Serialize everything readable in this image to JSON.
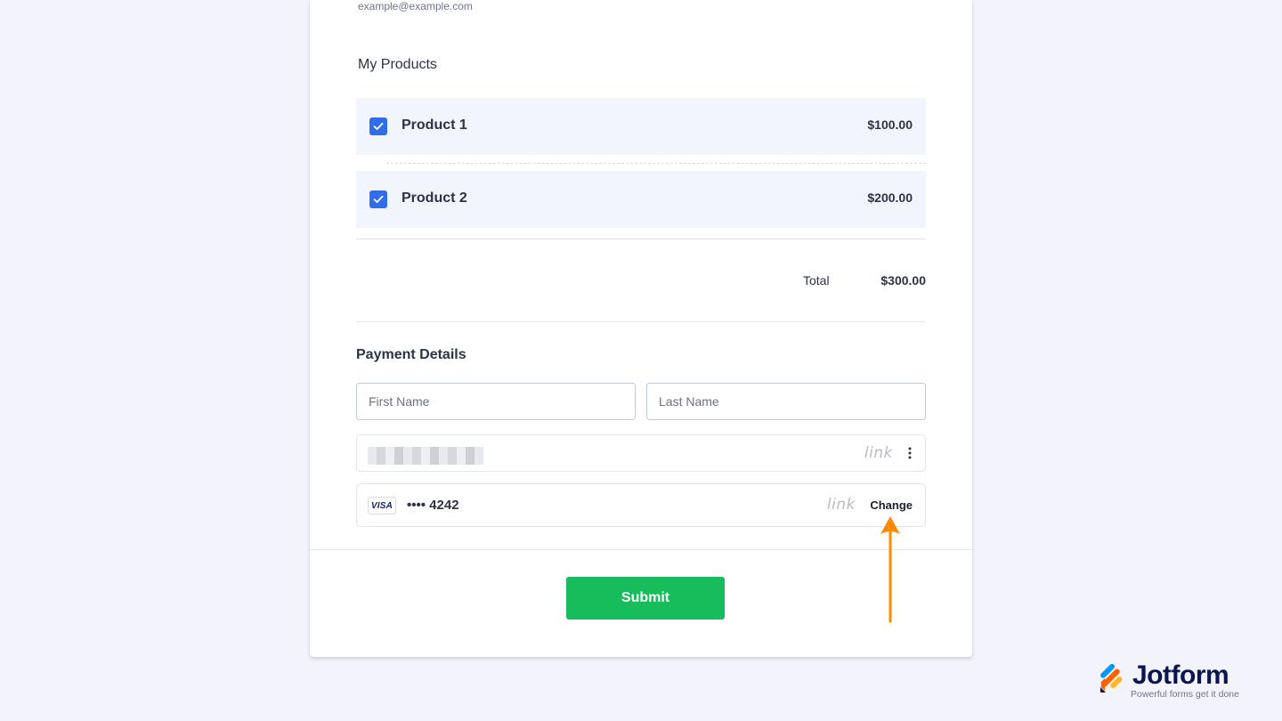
{
  "form": {
    "email_value": "example@example.com",
    "products_label": "My Products",
    "products": [
      {
        "name": "Product 1",
        "price": "$100.00",
        "checked": true
      },
      {
        "name": "Product 2",
        "price": "$200.00",
        "checked": true
      }
    ],
    "total_label": "Total",
    "total_value": "$300.00",
    "payment_title": "Payment Details",
    "first_name_placeholder": "First Name",
    "last_name_placeholder": "Last Name",
    "link_logo_text": "link",
    "card": {
      "brand": "VISA",
      "number_masked": "•••• 4242",
      "change_label": "Change"
    },
    "submit_label": "Submit"
  },
  "brand": {
    "name": "Jotform",
    "tagline": "Powerful forms get it done"
  },
  "colors": {
    "checkbox": "#2f6ee8",
    "submit": "#18bd5b",
    "arrow": "#ff8a00",
    "background": "#f3f4fb"
  }
}
